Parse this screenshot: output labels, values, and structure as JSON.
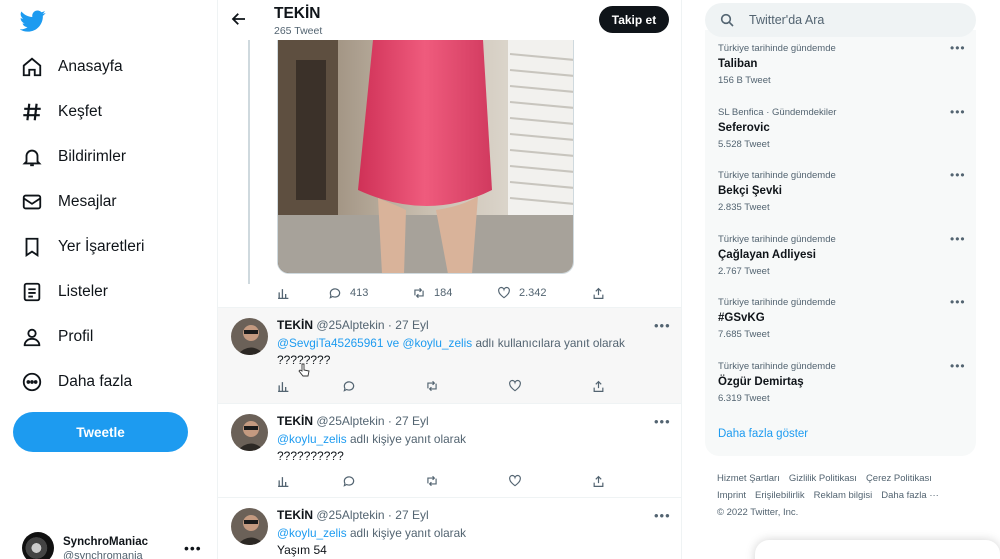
{
  "nav": {
    "items": [
      {
        "label": "Anasayfa",
        "icon": "home-icon"
      },
      {
        "label": "Keşfet",
        "icon": "hashtag-icon"
      },
      {
        "label": "Bildirimler",
        "icon": "bell-icon"
      },
      {
        "label": "Mesajlar",
        "icon": "mail-icon"
      },
      {
        "label": "Yer İşaretleri",
        "icon": "bookmark-icon"
      },
      {
        "label": "Listeler",
        "icon": "list-icon"
      },
      {
        "label": "Profil",
        "icon": "person-icon"
      },
      {
        "label": "Daha fazla",
        "icon": "more-circle-icon"
      }
    ],
    "tweet_button": "Tweetle"
  },
  "account": {
    "name": "SynchroManiac",
    "handle": "@synchromania",
    "more": "•••"
  },
  "header": {
    "title": "TEKİN",
    "subtitle": "265 Tweet",
    "follow_button": "Takip et"
  },
  "main_tweet": {
    "counts": {
      "replies": "413",
      "retweets": "184",
      "likes": "2.342"
    }
  },
  "replies": [
    {
      "name": "TEKİN",
      "handle": "@25Alptekin",
      "sep": "·",
      "date": "27 Eyl",
      "mention1": "@SevgiTa45265961",
      "connector": "ve",
      "mention2": "@koylu_zelis",
      "reply_suffix": "adlı kullanıcılara yanıt olarak",
      "text": "????????"
    },
    {
      "name": "TEKİN",
      "handle": "@25Alptekin",
      "sep": "·",
      "date": "27 Eyl",
      "mention1": "@koylu_zelis",
      "reply_suffix": "adlı kişiye yanıt olarak",
      "text": "??????????"
    },
    {
      "name": "TEKİN",
      "handle": "@25Alptekin",
      "sep": "·",
      "date": "27 Eyl",
      "mention1": "@koylu_zelis",
      "reply_suffix": "adlı kişiye yanıt olarak",
      "text": "Yaşım 54"
    }
  ],
  "search": {
    "placeholder": "Twitter'da Ara"
  },
  "trends": [
    {
      "context": "Türkiye tarihinde gündemde",
      "name": "Taliban",
      "count": "156 B Tweet"
    },
    {
      "context": "SL Benfica · Gündemdekiler",
      "name": "Seferovic",
      "count": "5.528 Tweet"
    },
    {
      "context": "Türkiye tarihinde gündemde",
      "name": "Bekçi Şevki",
      "count": "2.835 Tweet"
    },
    {
      "context": "Türkiye tarihinde gündemde",
      "name": "Çağlayan Adliyesi",
      "count": "2.767 Tweet"
    },
    {
      "context": "Türkiye tarihinde gündemde",
      "name": "#GSvKG",
      "count": "7.685 Tweet"
    },
    {
      "context": "Türkiye tarihinde gündemde",
      "name": "Özgür Demirtaş",
      "count": "6.319 Tweet"
    }
  ],
  "trend_more": "•••",
  "show_more": "Daha fazla göster",
  "footer": {
    "links": [
      "Hizmet Şartları",
      "Gizlilik Politikası",
      "Çerez Politikası",
      "Imprint",
      "Erişilebilirlik",
      "Reklam bilgisi",
      "Daha fazla ···"
    ],
    "copyright": "© 2022 Twitter, Inc."
  },
  "colors": {
    "accent": "#1d9bf0",
    "text": "#0f1419",
    "muted": "#536471",
    "dress": "#e8456b"
  }
}
